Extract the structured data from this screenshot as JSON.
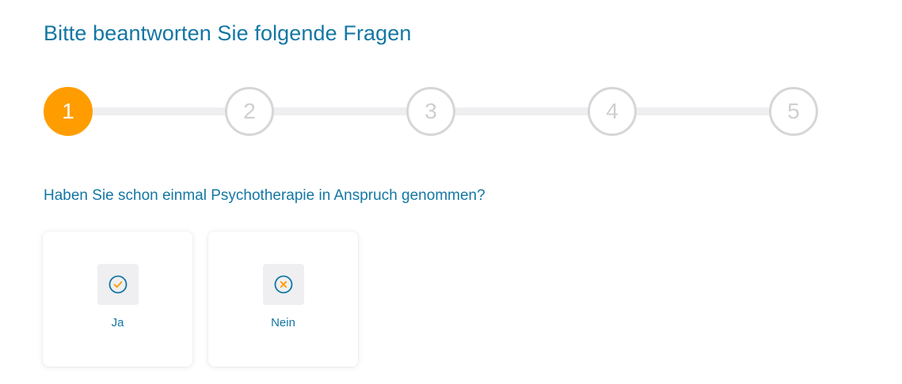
{
  "title": "Bitte beantworten Sie folgende Fragen",
  "stepper": {
    "current_step": 1,
    "steps": [
      {
        "label": "1",
        "state": "active"
      },
      {
        "label": "2",
        "state": "inactive"
      },
      {
        "label": "3",
        "state": "inactive"
      },
      {
        "label": "4",
        "state": "inactive"
      },
      {
        "label": "5",
        "state": "inactive"
      }
    ]
  },
  "question": {
    "text": "Haben Sie schon einmal Psychotherapie in Anspruch genommen?",
    "options": [
      {
        "label": "Ja",
        "icon": "check-circle-icon"
      },
      {
        "label": "Nein",
        "icon": "x-circle-icon"
      }
    ]
  },
  "colors": {
    "primary": "#1477a4",
    "accent": "#ff9d00",
    "inactive_step": "#d6d6d8",
    "track": "#efeef0",
    "icon_bg": "#efeff1"
  }
}
